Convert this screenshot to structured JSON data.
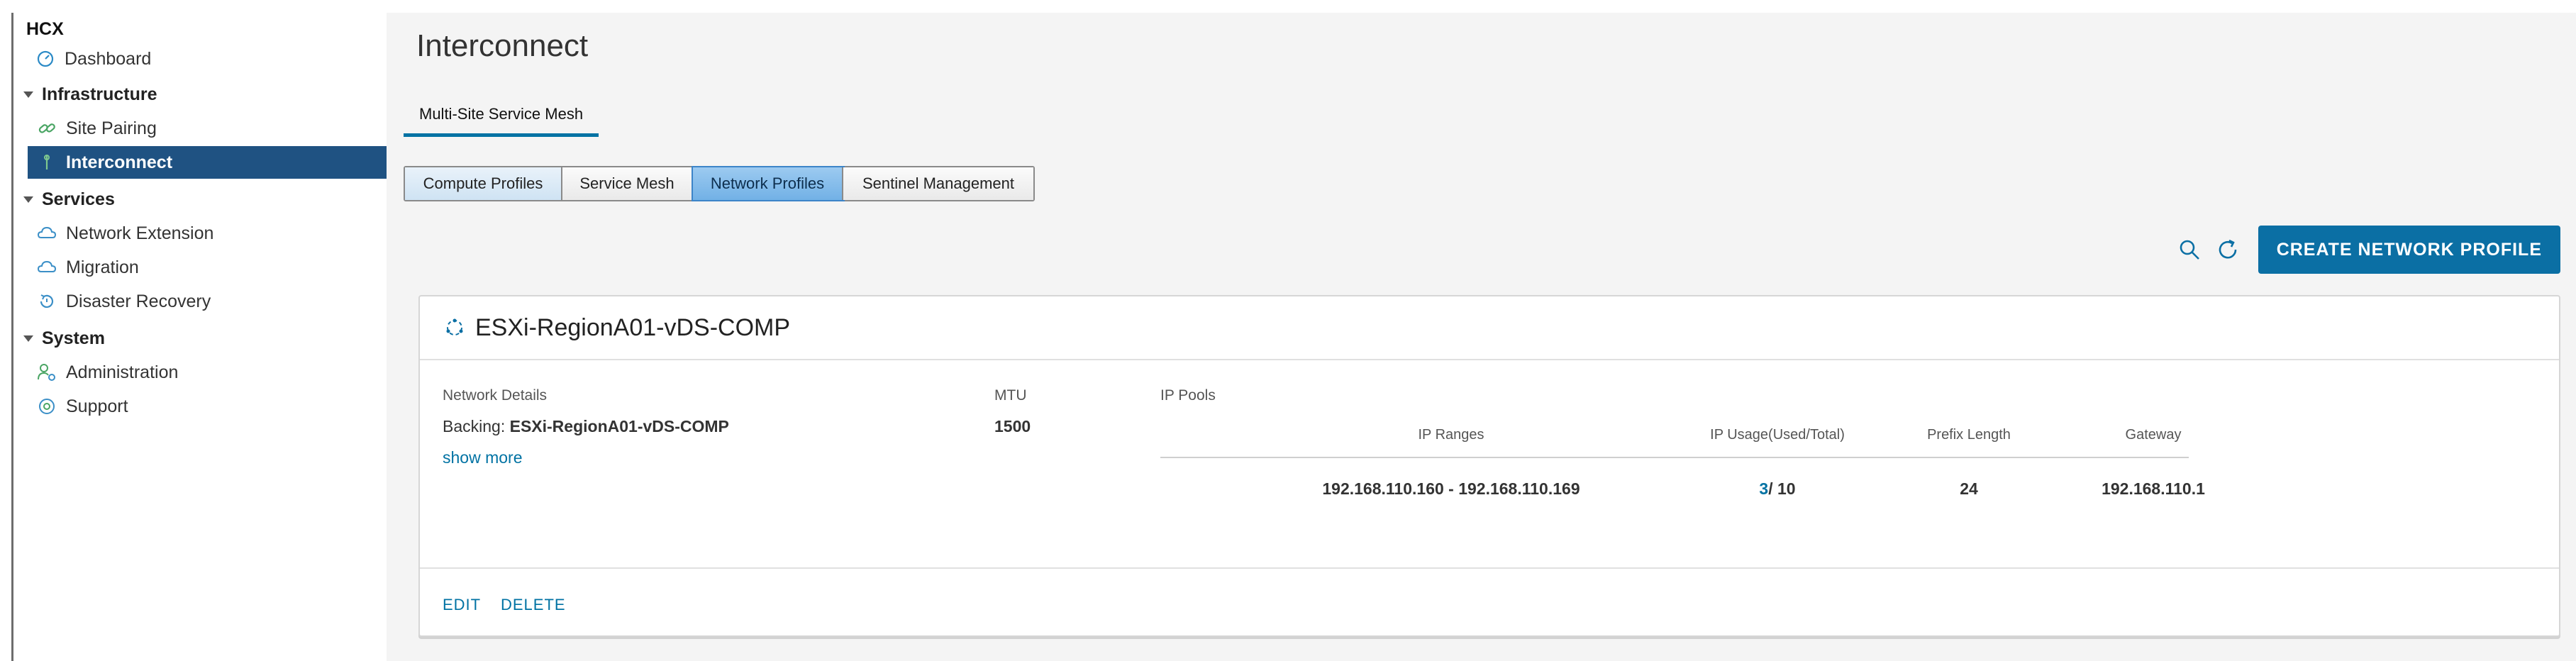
{
  "app": {
    "name": "HCX"
  },
  "sidebar": {
    "dashboard": "Dashboard",
    "infrastructure": {
      "label": "Infrastructure",
      "items": [
        "Site Pairing",
        "Interconnect"
      ]
    },
    "services": {
      "label": "Services",
      "items": [
        "Network Extension",
        "Migration",
        "Disaster Recovery"
      ]
    },
    "system": {
      "label": "System",
      "items": [
        "Administration",
        "Support"
      ]
    }
  },
  "main": {
    "title": "Interconnect",
    "tab": "Multi-Site Service Mesh",
    "segments": [
      "Compute Profiles",
      "Service Mesh",
      "Network Profiles",
      "Sentinel Management"
    ],
    "selected_segment": "Network Profiles",
    "create_button": "CREATE NETWORK PROFILE"
  },
  "profile": {
    "name": "ESXi-RegionA01-vDS-COMP",
    "network_details_label": "Network Details",
    "backing_label": "Backing:",
    "backing_value": "ESXi-RegionA01-vDS-COMP",
    "show_more": "show more",
    "mtu_label": "MTU",
    "mtu_value": "1500",
    "ip_pools_label": "IP Pools",
    "pool_headers": {
      "ranges": "IP Ranges",
      "usage": "IP Usage(Used/Total)",
      "prefix": "Prefix Length",
      "gateway": "Gateway"
    },
    "pool_row": {
      "ranges": "192.168.110.160 - 192.168.110.169",
      "used": "3",
      "total": "/ 10",
      "prefix": "24",
      "gateway": "192.168.110.1"
    },
    "edit": "EDIT",
    "delete": "DELETE"
  },
  "colors": {
    "primary": "#0b6fa4",
    "sidebar_active": "#1f5282",
    "link": "#0072a3"
  }
}
